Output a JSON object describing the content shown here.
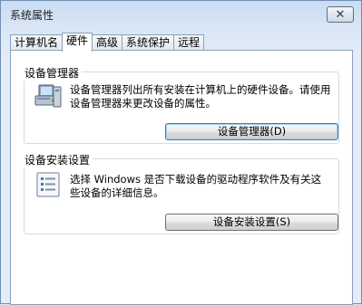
{
  "window": {
    "title": "系统属性"
  },
  "tabs": [
    {
      "label": "计算机名"
    },
    {
      "label": "硬件"
    },
    {
      "label": "高级"
    },
    {
      "label": "系统保护"
    },
    {
      "label": "远程"
    }
  ],
  "device_manager": {
    "title": "设备管理器",
    "description": "设备管理器列出所有安装在计算机上的硬件设备。请使用设备管理器来更改设备的属性。",
    "button_label": "设备管理器(D)",
    "icon": "device-manager-icon"
  },
  "device_install": {
    "title": "设备安装设置",
    "description": "选择 Windows 是否下载设备的驱动程序软件及有关这些设备的详细信息。",
    "button_label": "设备安装设置(S)",
    "icon": "checklist-icon"
  }
}
